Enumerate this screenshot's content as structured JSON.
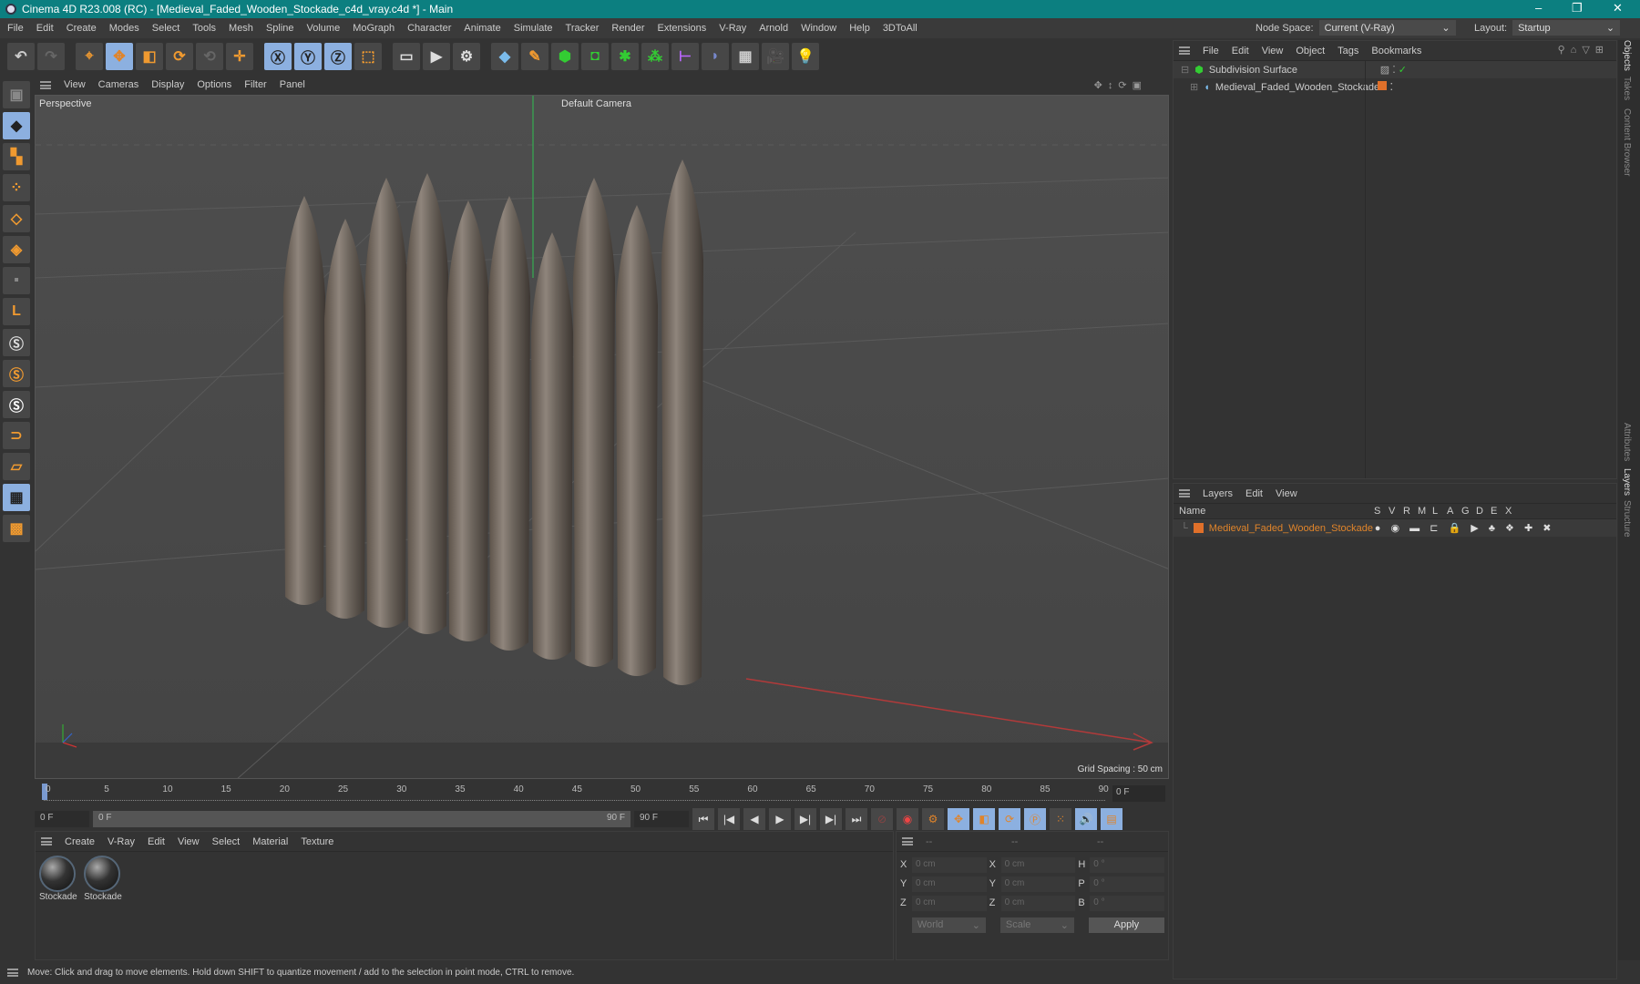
{
  "title": "Cinema 4D R23.008 (RC) - [Medieval_Faded_Wooden_Stockade_c4d_vray.c4d *] - Main",
  "menu": [
    "File",
    "Edit",
    "Create",
    "Modes",
    "Select",
    "Tools",
    "Mesh",
    "Spline",
    "Volume",
    "MoGraph",
    "Character",
    "Animate",
    "Simulate",
    "Tracker",
    "Render",
    "Extensions",
    "V-Ray",
    "Arnold",
    "Window",
    "Help",
    "3DToAll"
  ],
  "node_space": {
    "label": "Node Space:",
    "value": "Current (V-Ray)"
  },
  "layout": {
    "label": "Layout:",
    "value": "Startup"
  },
  "viewport": {
    "menu": [
      "View",
      "Cameras",
      "Display",
      "Options",
      "Filter",
      "Panel"
    ],
    "label": "Perspective",
    "camera": "Default Camera",
    "grid": "Grid Spacing : 50 cm"
  },
  "timeline": {
    "ticks": [
      "0",
      "5",
      "10",
      "15",
      "20",
      "25",
      "30",
      "35",
      "40",
      "45",
      "50",
      "55",
      "60",
      "65",
      "70",
      "75",
      "80",
      "85",
      "90"
    ],
    "current": "0 F",
    "start": "0 F",
    "range_start": "0 F",
    "range_end": "90 F",
    "end": "90 F"
  },
  "materials": {
    "menu": [
      "Create",
      "V-Ray",
      "Edit",
      "View",
      "Select",
      "Material",
      "Texture"
    ],
    "items": [
      "Stockade",
      "Stockade"
    ]
  },
  "coords": {
    "headers": [
      "--",
      "--",
      "--"
    ],
    "rows": [
      [
        "X",
        "0 cm",
        "X",
        "0 cm",
        "H",
        "0 °"
      ],
      [
        "Y",
        "0 cm",
        "Y",
        "0 cm",
        "P",
        "0 °"
      ],
      [
        "Z",
        "0 cm",
        "Z",
        "0 cm",
        "B",
        "0 °"
      ]
    ],
    "world": "World",
    "scale": "Scale",
    "apply": "Apply"
  },
  "status": "Move: Click and drag to move elements. Hold down SHIFT to quantize movement / add to the selection in point mode, CTRL to remove.",
  "objects": {
    "menu": [
      "File",
      "Edit",
      "View",
      "Object",
      "Tags",
      "Bookmarks"
    ],
    "items": [
      "Subdivision Surface",
      "Medieval_Faded_Wooden_Stockade"
    ]
  },
  "layers": {
    "menu": [
      "Layers",
      "Edit",
      "View"
    ],
    "name_header": "Name",
    "cols": [
      "S",
      "V",
      "R",
      "M",
      "L",
      "A",
      "G",
      "D",
      "E",
      "X"
    ],
    "item": "Medieval_Faded_Wooden_Stockade",
    "color": "#e0702a"
  },
  "side_tabs": [
    "Objects",
    "Takes",
    "Content Browser",
    "Attributes",
    "Layers",
    "Structure"
  ]
}
